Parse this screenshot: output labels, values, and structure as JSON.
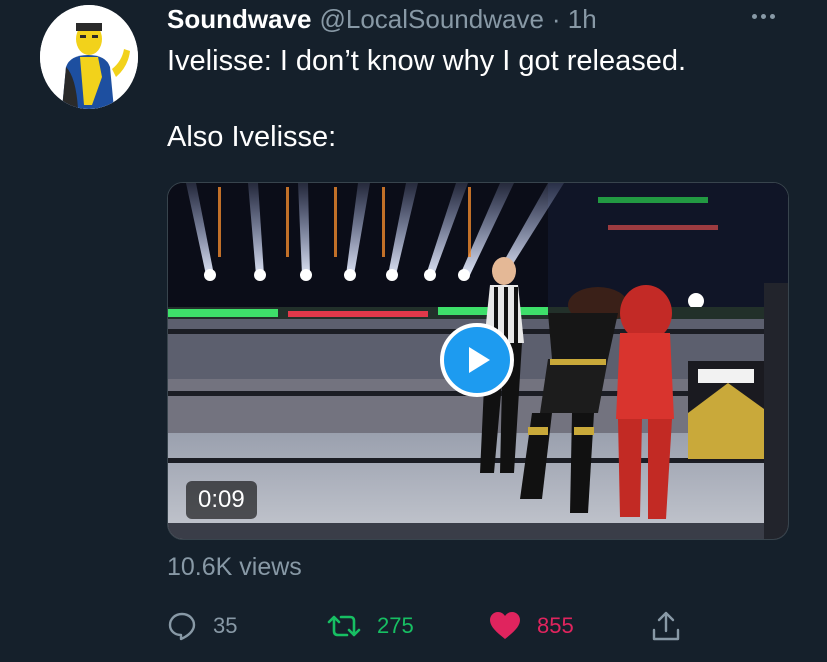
{
  "tweet": {
    "display_name": "Soundwave",
    "handle": "@LocalSoundwave",
    "timestamp": "· 1h",
    "text": "Ivelisse: I don’t know why I got released.\n\nAlso Ivelisse:",
    "media": {
      "type": "video",
      "duration": "0:09",
      "play_icon": "play-icon"
    },
    "views": "10.6K views",
    "stats": {
      "replies": "35",
      "retweets": "275",
      "likes": "855"
    }
  },
  "icons": {
    "more": "more-icon",
    "reply": "reply-icon",
    "retweet": "retweet-icon",
    "like": "heart-icon",
    "share": "share-icon"
  },
  "colors": {
    "background": "#15202b",
    "secondary_text": "#8899a6",
    "retweet": "#17bf63",
    "like": "#e0245e",
    "accent": "#1d9bf0"
  }
}
